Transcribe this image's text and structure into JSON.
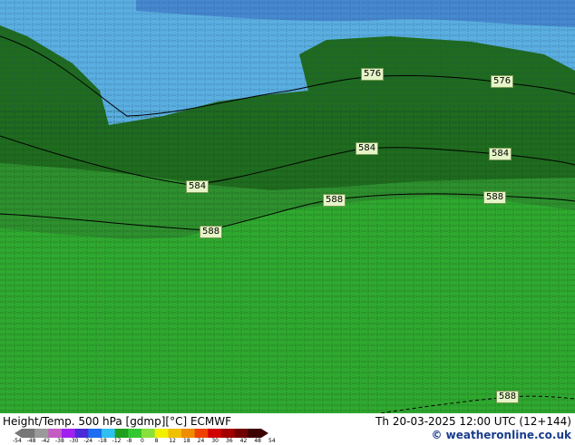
{
  "map": {
    "contour_labels": [
      "576",
      "576",
      "584",
      "584",
      "584",
      "588",
      "588",
      "588",
      "588"
    ],
    "colors": {
      "cold_field": "#5aaee0",
      "dark_green": "#1f6b1f",
      "mid_green": "#2e8f2e",
      "bright_green": "#2fa82f",
      "label_bg": "#e6f5c8"
    }
  },
  "footer": {
    "title": "Height/Temp. 500 hPa [gdmp][°C] ECMWF",
    "datetime": "Th 20-03-2025 12:00 UTC (12+144)",
    "credit": "© weatheronline.co.uk",
    "colorbar_ticks": [
      "-54",
      "-48",
      "-42",
      "-38",
      "-30",
      "-24",
      "-18",
      "-12",
      "-8",
      "0",
      "8",
      "12",
      "18",
      "24",
      "30",
      "36",
      "42",
      "48",
      "54"
    ],
    "colorbar_colors": [
      "#777777",
      "#9a9a9a",
      "#c45cc4",
      "#a020f0",
      "#4b2bd8",
      "#1e6cf0",
      "#2ec0f0",
      "#1ea01e",
      "#32c832",
      "#8ae03a",
      "#f0f000",
      "#f0c000",
      "#f08c00",
      "#f04000",
      "#d00000",
      "#a00000",
      "#700000",
      "#3c0000"
    ]
  }
}
